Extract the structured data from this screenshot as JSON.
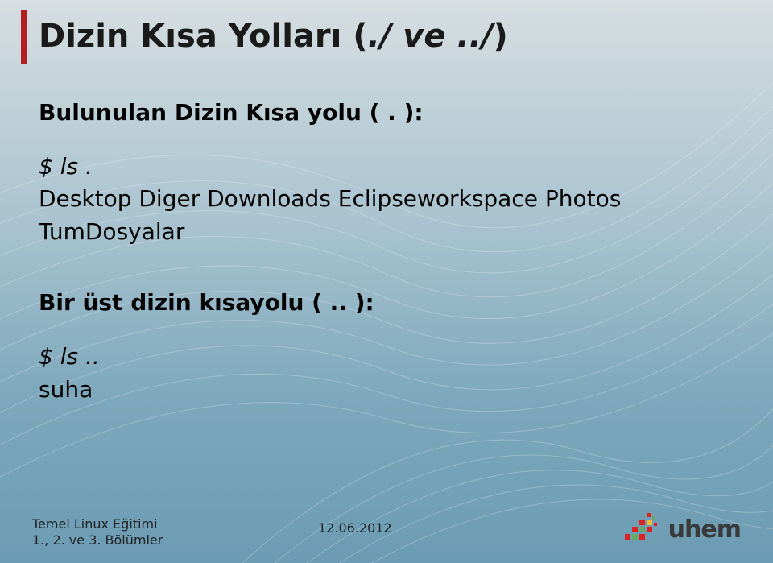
{
  "title_plain": "Dizin Kısa Yolları (",
  "title_ital": "./ ve ../",
  "title_end": ")",
  "section1": {
    "heading": "Bulunulan Dizin Kısa yolu ( . ):",
    "command": "$ ls .",
    "output_line1": "Desktop Diger Downloads Eclipseworkspace Photos",
    "output_line2": "TumDosyalar"
  },
  "section2": {
    "heading": "Bir üst dizin kısayolu ( .. ):",
    "command": "$ ls ..",
    "output": "suha"
  },
  "footer": {
    "line1": "Temel Linux Eğitimi",
    "line2": "1., 2. ve 3. Bölümler",
    "date": "12.06.2012"
  },
  "logo_text": "uhem"
}
